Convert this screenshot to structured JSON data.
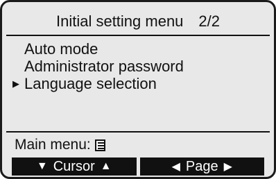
{
  "title": {
    "text": "Initial setting menu",
    "page": "2/2"
  },
  "menu_items": [
    {
      "label": "Auto mode",
      "selected": false
    },
    {
      "label": "Administrator password",
      "selected": false
    },
    {
      "label": "Language selection",
      "selected": true
    }
  ],
  "footer": {
    "main_menu_label": "Main menu:",
    "main_menu_icon": "menu-list-icon"
  },
  "function_keys": [
    {
      "label": "Cursor",
      "left_icon": "▼",
      "right_icon": "▲"
    },
    {
      "label": "Page",
      "left_icon": "◀",
      "right_icon": "▶"
    }
  ],
  "colors": {
    "screen_bg": "#e8e8e8",
    "text": "#111111",
    "fkey_bg": "#111111",
    "fkey_text": "#ffffff"
  }
}
